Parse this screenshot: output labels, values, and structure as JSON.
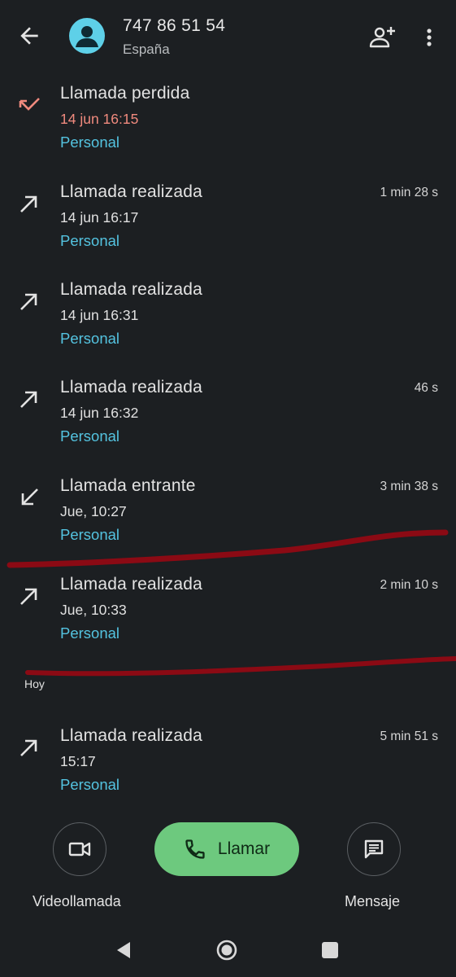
{
  "header": {
    "title": "747 86 51 54",
    "subtitle": "España"
  },
  "calls": [
    {
      "type": "Llamada perdida",
      "time": "14 jun 16:15",
      "account": "Personal",
      "duration": "",
      "direction": "missed"
    },
    {
      "type": "Llamada realizada",
      "time": "14 jun 16:17",
      "account": "Personal",
      "duration": "1 min 28 s",
      "direction": "outgoing"
    },
    {
      "type": "Llamada realizada",
      "time": "14 jun 16:31",
      "account": "Personal",
      "duration": "",
      "direction": "outgoing"
    },
    {
      "type": "Llamada realizada",
      "time": "14 jun 16:32",
      "account": "Personal",
      "duration": "46 s",
      "direction": "outgoing"
    },
    {
      "type": "Llamada entrante",
      "time": "Jue, 10:27",
      "account": "Personal",
      "duration": "3 min 38 s",
      "direction": "incoming"
    },
    {
      "type": "Llamada realizada",
      "time": "Jue, 10:33",
      "account": "Personal",
      "duration": "2 min 10 s",
      "direction": "outgoing"
    },
    {
      "type": "Llamada realizada",
      "time": "15:17",
      "account": "Personal",
      "duration": "5 min 51 s",
      "direction": "outgoing"
    }
  ],
  "section_label": "Hoy",
  "actions": {
    "video_label": "Videollamada",
    "call_label": "Llamar",
    "message_label": "Mensaje"
  },
  "colors": {
    "background": "#1c1f22",
    "missed": "#f08a7e",
    "account": "#54c3e0",
    "call_button": "#6dc97e",
    "avatar": "#5ed0e8",
    "strike": "#8b0a14"
  }
}
